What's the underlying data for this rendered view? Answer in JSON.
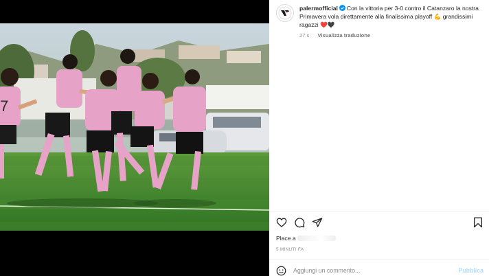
{
  "post": {
    "username": "palermofficial",
    "caption": "Con la vittoria per 3-0 contro il Catanzaro la nostra Primavera vola direttamente alla finalissima playoff 💪 grandissimi ragazzi ❤️🖤",
    "time_ago": "27 s",
    "translate_label": "Visualizza traduzione",
    "likes_prefix": "Place a",
    "posted_ago": "5 MINUTI FA"
  },
  "comment": {
    "placeholder": "Aggiungi un commento...",
    "publish_label": "Pubblica"
  },
  "icons": [
    "palermo-logo-icon",
    "verified-badge-icon",
    "heart-icon",
    "comment-icon",
    "share-icon",
    "bookmark-icon",
    "emoji-icon"
  ],
  "colors": {
    "accent_blue": "#0095f6",
    "publish_disabled": "#b3dbff",
    "jersey_pink": "#e7a1c3",
    "pitch_green": "#3f8a2e"
  }
}
